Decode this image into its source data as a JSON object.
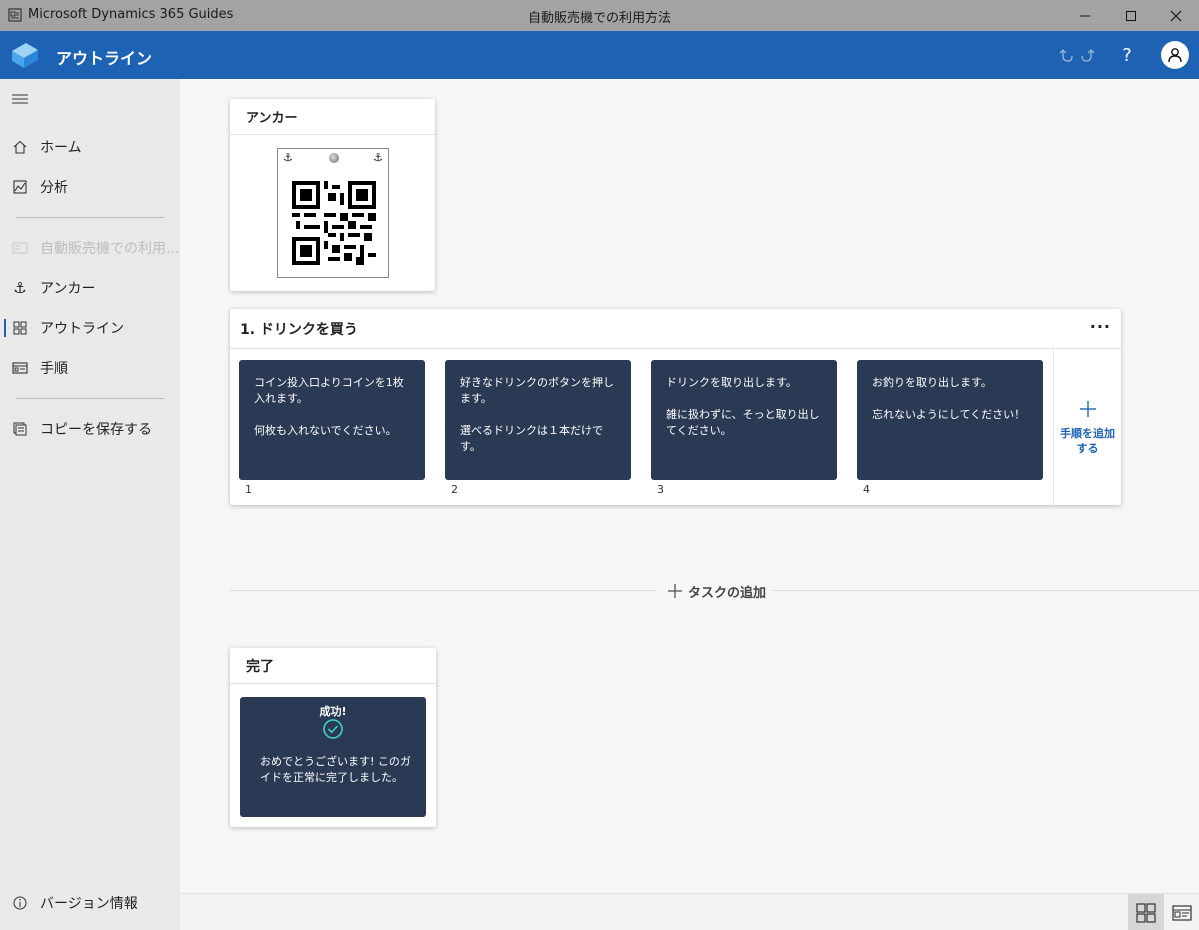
{
  "window": {
    "app_name": "Microsoft Dynamics 365 Guides",
    "document_title": "自動販売機での利用方法"
  },
  "header": {
    "title": "アウトライン"
  },
  "sidebar": {
    "items": [
      {
        "label": "ホーム",
        "icon": "home-icon"
      },
      {
        "label": "分析",
        "icon": "analytics-icon"
      },
      {
        "label": "自動販売機での利用...",
        "icon": "guide-icon"
      },
      {
        "label": "アンカー",
        "icon": "anchor-icon"
      },
      {
        "label": "アウトライン",
        "icon": "outline-icon"
      },
      {
        "label": "手順",
        "icon": "steps-icon"
      },
      {
        "label": "コピーを保存する",
        "icon": "save-copy-icon"
      }
    ],
    "footer_label": "バージョン情報"
  },
  "anchor_card": {
    "title": "アンカー"
  },
  "task": {
    "title": "1. ドリンクを買う",
    "more": "···",
    "steps": [
      {
        "num": "1",
        "line1": "コイン投入口よりコインを1枚入れます。",
        "line2": "何枚も入れないでください。"
      },
      {
        "num": "2",
        "line1": "好きなドリンクのボタンを押します。",
        "line2": "選べるドリンクは１本だけです。"
      },
      {
        "num": "3",
        "line1": "ドリンクを取り出します。",
        "line2": "雑に扱わずに、そっと取り出してください。"
      },
      {
        "num": "4",
        "line1": "お釣りを取り出します。",
        "line2": "忘れないようにしてください！"
      }
    ],
    "add_step_label": "手順を追加する"
  },
  "add_task_label": "タスクの追加",
  "completion": {
    "title": "完了",
    "heading": "成功!",
    "message": "おめでとうございます! このガイドを正常に完了しました。"
  },
  "colors": {
    "accent": "#1e63b3",
    "step_card": "#2b3a54",
    "success": "#3fd1c0"
  }
}
